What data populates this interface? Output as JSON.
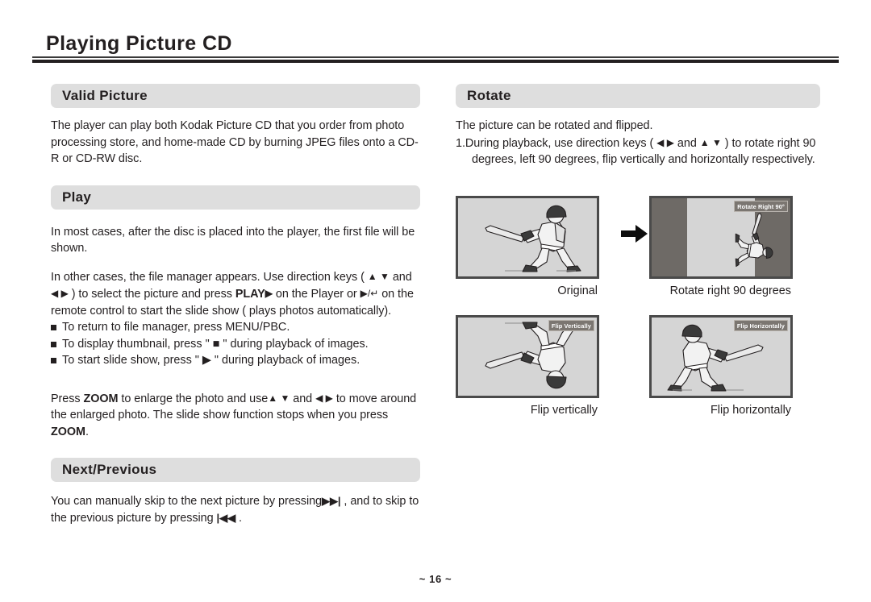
{
  "document": {
    "title": "Playing Picture CD",
    "page_number": "~ 16 ~"
  },
  "left_column": {
    "valid_picture": {
      "heading": "Valid Picture",
      "paragraph": "The player can play both Kodak Picture CD that you order from photo processing store, and home-made CD by burning JPEG files onto a CD-R or CD-RW disc."
    },
    "play": {
      "heading": "Play",
      "paragraph_1": "In most cases, after the disc is placed into the player, the first file will be shown.",
      "paragraph_2_a": "In other cases, the file manager appears. Use direction keys ( ",
      "paragraph_2_arrows_ud": "▲ ▼",
      "paragraph_2_b": " and ",
      "paragraph_2_arrows_lr": "◀ ▶",
      "paragraph_2_c": " ) to select the picture and press ",
      "paragraph_2_play": "PLAY",
      "paragraph_2_play_arrow": "▶",
      "paragraph_2_d": " on the Player or ",
      "paragraph_2_remote": "▶/↵",
      "paragraph_2_e": " on the remote control to start the slide show ( plays photos automatically).",
      "bullets": [
        "To return to file manager, press MENU/PBC.",
        "To display thumbnail, press \" ■ \" during playback of images.",
        "To start slide show, press \" ▶ \" during playback of images."
      ],
      "zoom_a": "Press ",
      "zoom_kw1": "ZOOM",
      "zoom_b": " to enlarge the photo and use",
      "zoom_arrows_ud": "▲ ▼",
      "zoom_c": " and ",
      "zoom_arrows_lr": "◀ ▶",
      "zoom_d": " to move around the enlarged photo. The slide show function stops when you press ",
      "zoom_kw2": "ZOOM",
      "zoom_e": "."
    },
    "next_previous": {
      "heading": "Next/Previous",
      "text_a": "You can manually skip to the next picture by pressing",
      "next_glyph": "▶▶|",
      "text_b": " , and to skip to the previous picture by pressing ",
      "prev_glyph": "|◀◀",
      "text_c": " ."
    }
  },
  "right_column": {
    "rotate": {
      "heading": "Rotate",
      "paragraph": "The picture can be rotated and flipped.",
      "step_number": "1.",
      "step_a": "During playback, use direction keys ( ",
      "step_arrows_lr": "◀ ▶",
      "step_b": " and ",
      "step_arrows_ud": "▲ ▼",
      "step_c": " ) to rotate right 90 degrees, left 90 degrees, flip vertically and horizontally respectively."
    },
    "figures": [
      {
        "id": "original",
        "caption": "Original",
        "badge": null
      },
      {
        "id": "rotate-right-90",
        "caption": "Rotate right 90 degrees",
        "badge": "Rotate Right 90°"
      },
      {
        "id": "flip-vertically",
        "caption": "Flip vertically",
        "badge": "Flip Vertically"
      },
      {
        "id": "flip-horizontally",
        "caption": "Flip horizontally",
        "badge": "Flip Horizontally"
      }
    ],
    "arrow_symbol": "➡"
  },
  "colors": {
    "section_bar": "#dedede",
    "text": "#231f20",
    "screen_fill": "#d5d5d5",
    "screen_border": "#4a4a4a",
    "letterbox": "#6e6a66",
    "badge_bg": "#7b7671"
  }
}
